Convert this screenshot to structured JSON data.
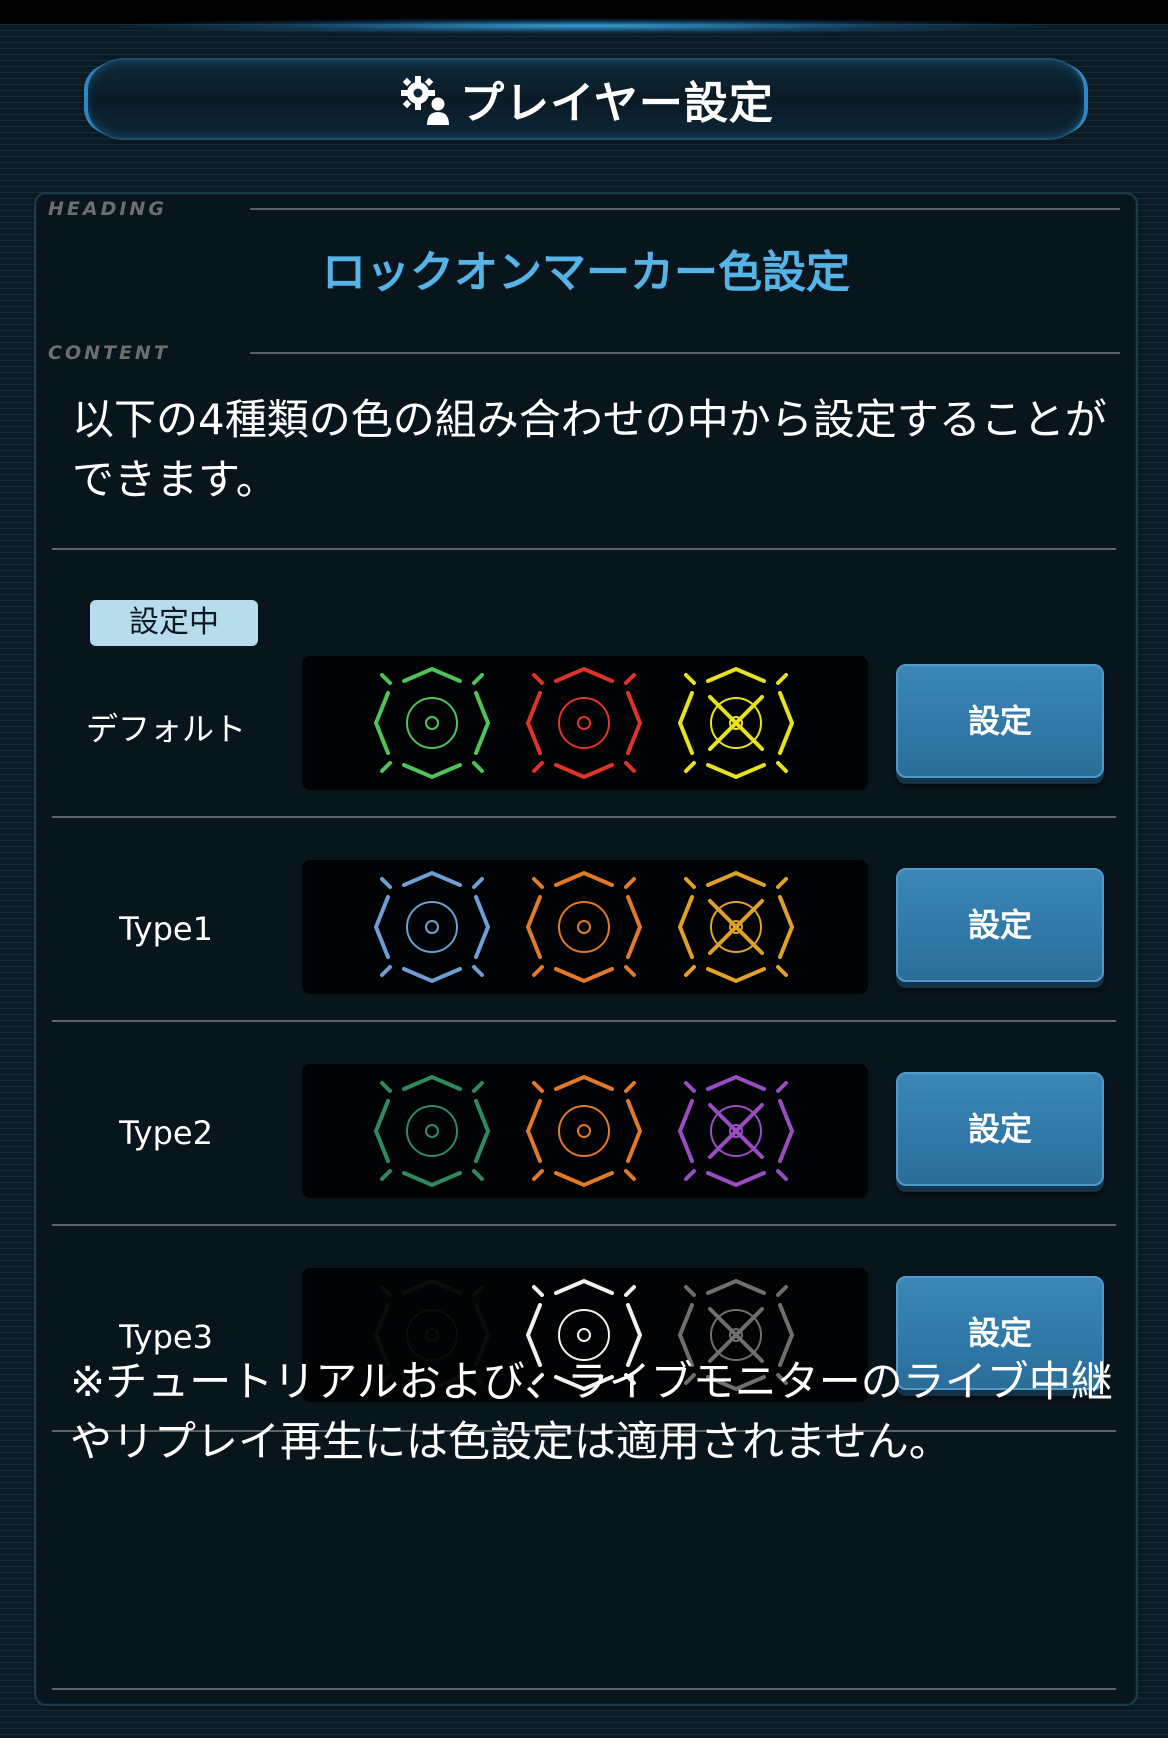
{
  "header": {
    "title": "プレイヤー設定",
    "icon": "gear-person-icon"
  },
  "heading": {
    "section_label": "HEADING",
    "title": "ロックオンマーカー色設定"
  },
  "content": {
    "section_label": "CONTENT",
    "description": "以下の4種類の色の組み合わせの中から設定することができます。"
  },
  "options": [
    {
      "name": "デフォルト",
      "badge": "設定中",
      "button": "設定",
      "colors": [
        "#4fc35a",
        "#e0332b",
        "#e8e21e"
      ]
    },
    {
      "name": "Type1",
      "button": "設定",
      "colors": [
        "#6f9fd2",
        "#e07a2a",
        "#e0a02a"
      ]
    },
    {
      "name": "Type2",
      "button": "設定",
      "colors": [
        "#2f8a5f",
        "#e07a2a",
        "#9a4cc2"
      ]
    },
    {
      "name": "Type3",
      "button": "設定",
      "colors": [
        "#0a0c0d",
        "#f2f2f2",
        "#6e6e6e"
      ]
    }
  ],
  "note": "※チュートリアルおよび、ライブモニターのライブ中継やリプレイ再生には色設定は適用されません。"
}
